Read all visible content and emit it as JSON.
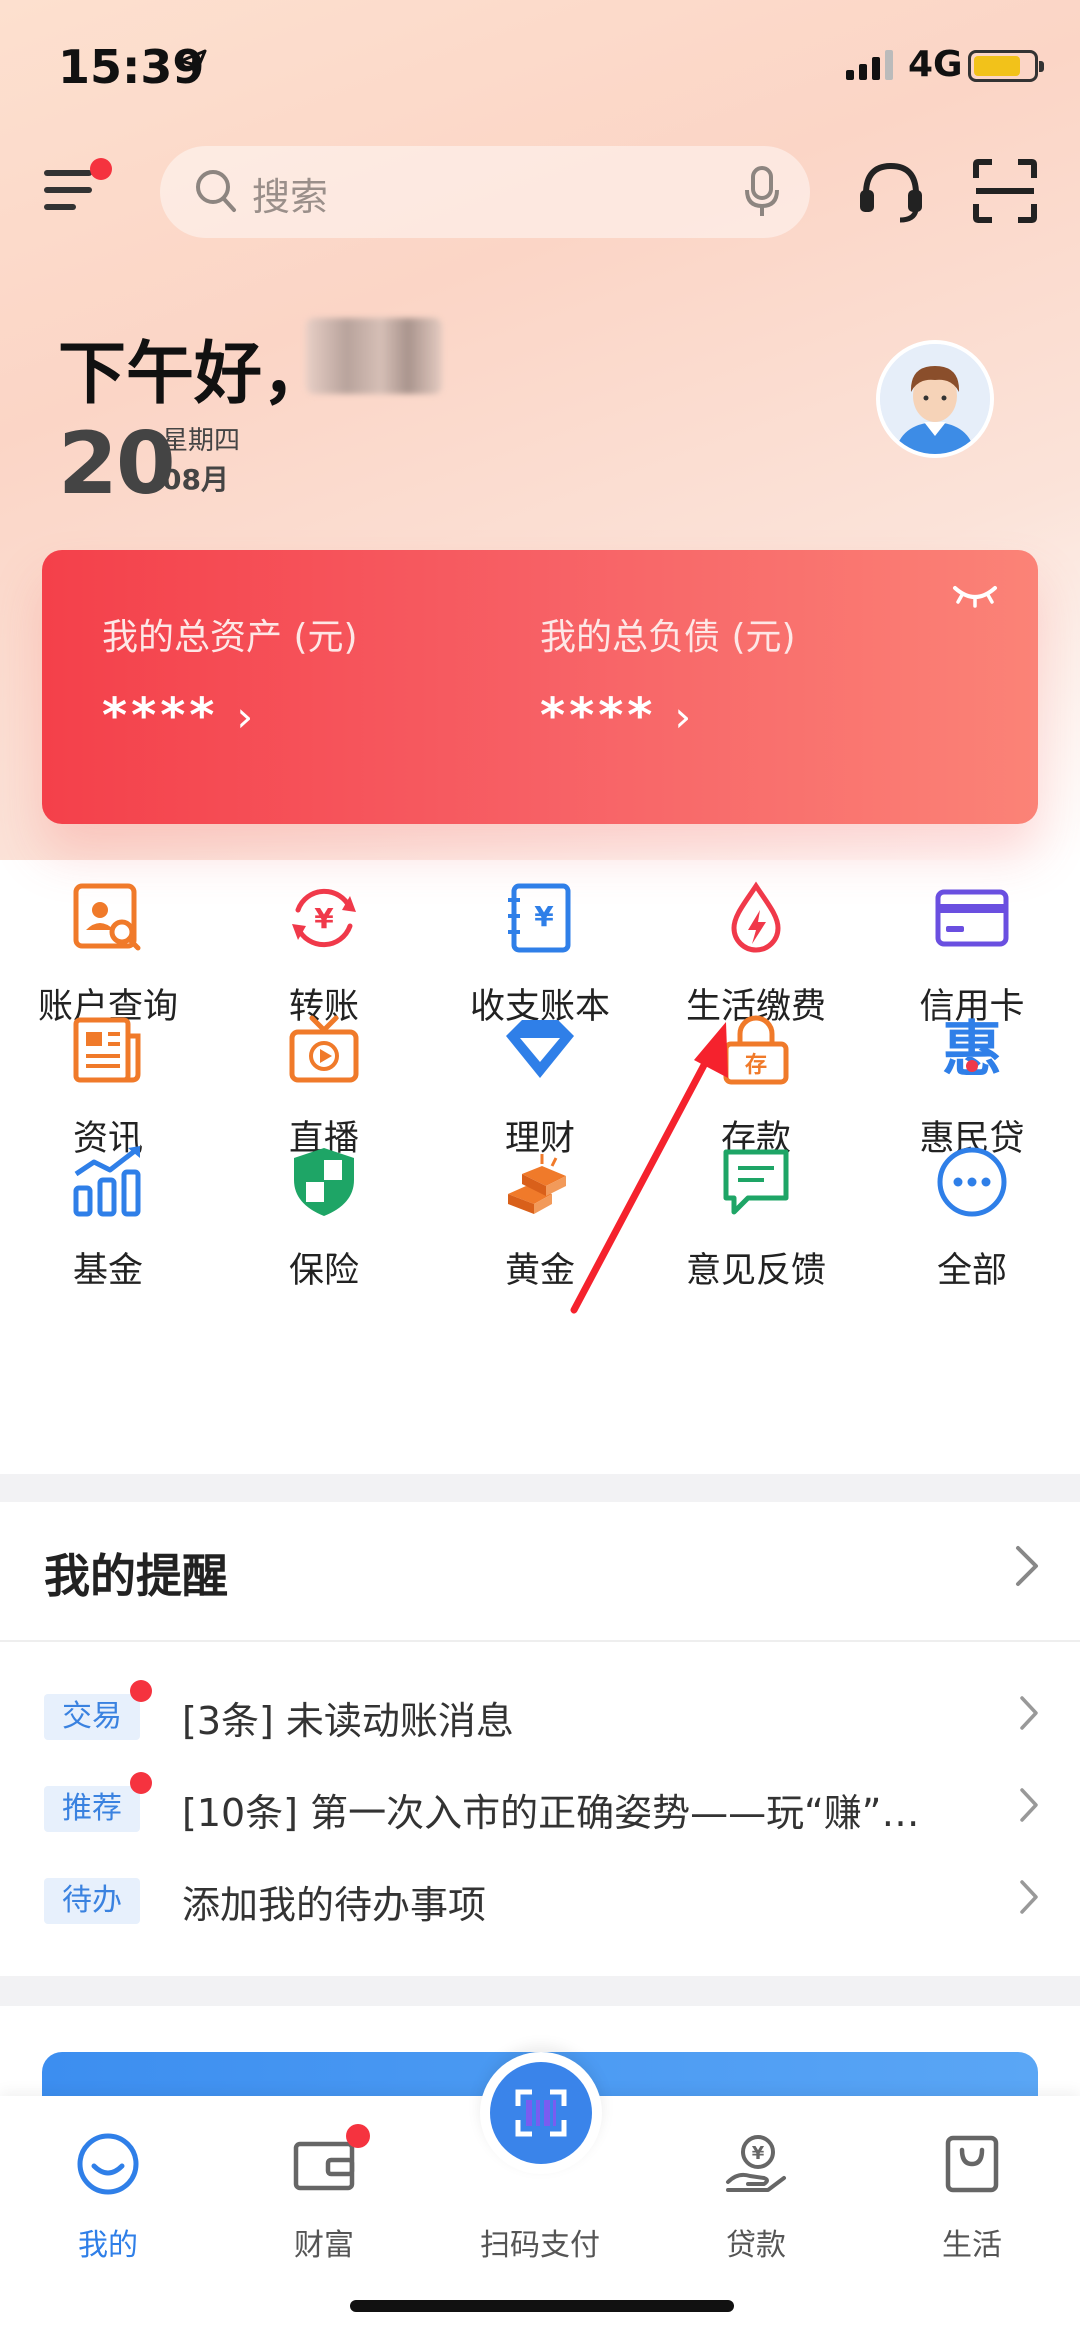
{
  "status": {
    "time": "15:39",
    "network": "4G"
  },
  "header": {
    "search_placeholder": "搜索"
  },
  "greeting": {
    "text": "下午好，",
    "day": "20",
    "weekday": "星期四",
    "month": "08月"
  },
  "assets": {
    "total_assets_label": "我的总资产 (元)",
    "total_assets_value": "****",
    "total_debt_label": "我的总负债 (元)",
    "total_debt_value": "****"
  },
  "services": [
    {
      "label": "账户查询",
      "icon": "account-query-icon"
    },
    {
      "label": "转账",
      "icon": "transfer-icon"
    },
    {
      "label": "收支账本",
      "icon": "ledger-icon"
    },
    {
      "label": "生活缴费",
      "icon": "utility-payment-icon"
    },
    {
      "label": "信用卡",
      "icon": "credit-card-icon"
    },
    {
      "label": "资讯",
      "icon": "news-icon"
    },
    {
      "label": "直播",
      "icon": "live-tv-icon"
    },
    {
      "label": "理财",
      "icon": "diamond-icon"
    },
    {
      "label": "存款",
      "icon": "deposit-lock-icon"
    },
    {
      "label": "惠民贷",
      "icon": "huimin-loan-icon"
    },
    {
      "label": "基金",
      "icon": "fund-chart-icon"
    },
    {
      "label": "保险",
      "icon": "shield-icon"
    },
    {
      "label": "黄金",
      "icon": "gold-bar-icon"
    },
    {
      "label": "意见反馈",
      "icon": "feedback-icon"
    },
    {
      "label": "全部",
      "icon": "more-icon"
    }
  ],
  "reminders": {
    "title": "我的提醒",
    "items": [
      {
        "tag": "交易",
        "text": "[3条] 未读动账消息",
        "unread": true
      },
      {
        "tag": "推荐",
        "text": "[10条] 第一次入市的正确姿势——玩“赚”…",
        "unread": true
      },
      {
        "tag": "待办",
        "text": "添加我的待办事项",
        "unread": false
      }
    ]
  },
  "tabbar": {
    "tabs": [
      {
        "label": "我的",
        "active": true
      },
      {
        "label": "财富",
        "badge": true
      },
      {
        "label": "扫码支付"
      },
      {
        "label": "贷款"
      },
      {
        "label": "生活"
      }
    ]
  },
  "colors": {
    "accent_blue": "#2f7fe8",
    "card_red": "#f4404a",
    "icon_orange": "#f07a2a",
    "badge_red": "#f5333f"
  }
}
